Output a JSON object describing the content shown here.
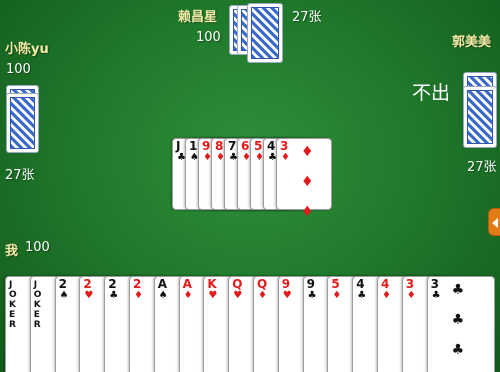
{
  "top_player": {
    "name": "赖昌星",
    "score": "100",
    "cards_left": "27张"
  },
  "left_player": {
    "name": "小陈yu",
    "score": "100",
    "cards_left": "27张"
  },
  "right_player": {
    "name": "郭美美",
    "cards_left": "27张",
    "action": "不出"
  },
  "self_player": {
    "name": "我",
    "score": "100"
  },
  "played_cards": [
    {
      "rank": "J",
      "suit": "♣",
      "color": "black"
    },
    {
      "rank": "10",
      "suit": "♠",
      "color": "black"
    },
    {
      "rank": "9",
      "suit": "♦",
      "color": "red"
    },
    {
      "rank": "8",
      "suit": "♦",
      "color": "red"
    },
    {
      "rank": "7",
      "suit": "♣",
      "color": "black"
    },
    {
      "rank": "6",
      "suit": "♦",
      "color": "red"
    },
    {
      "rank": "5",
      "suit": "♦",
      "color": "red"
    },
    {
      "rank": "4",
      "suit": "♣",
      "color": "black"
    },
    {
      "rank": "3",
      "suit": "♦",
      "color": "red"
    }
  ],
  "hand_cards": [
    {
      "rank": "JOKER",
      "suit": "",
      "color": "black"
    },
    {
      "rank": "JOKER",
      "suit": "",
      "color": "black"
    },
    {
      "rank": "2",
      "suit": "♠",
      "color": "black"
    },
    {
      "rank": "2",
      "suit": "♥",
      "color": "red"
    },
    {
      "rank": "2",
      "suit": "♣",
      "color": "black"
    },
    {
      "rank": "2",
      "suit": "♦",
      "color": "red"
    },
    {
      "rank": "A",
      "suit": "♠",
      "color": "black"
    },
    {
      "rank": "A",
      "suit": "♦",
      "color": "red"
    },
    {
      "rank": "K",
      "suit": "♥",
      "color": "red"
    },
    {
      "rank": "Q",
      "suit": "♥",
      "color": "red"
    },
    {
      "rank": "Q",
      "suit": "♦",
      "color": "red"
    },
    {
      "rank": "9",
      "suit": "♥",
      "color": "red"
    },
    {
      "rank": "9",
      "suit": "♣",
      "color": "black"
    },
    {
      "rank": "5",
      "suit": "♦",
      "color": "red"
    },
    {
      "rank": "4",
      "suit": "♣",
      "color": "black"
    },
    {
      "rank": "4",
      "suit": "♦",
      "color": "red"
    },
    {
      "rank": "3",
      "suit": "♦",
      "color": "red"
    },
    {
      "rank": "3",
      "suit": "♣",
      "color": "black"
    }
  ],
  "colors": {
    "felt": "#207a2c",
    "name_text": "#f4e9a6",
    "red_suit": "#e21b1b",
    "card_back": "#3c6ac9",
    "side_tab": "#e27d16"
  },
  "icons": {
    "card_back": "blue-pattern-card-back",
    "side_tab": "arrow-left-icon"
  }
}
